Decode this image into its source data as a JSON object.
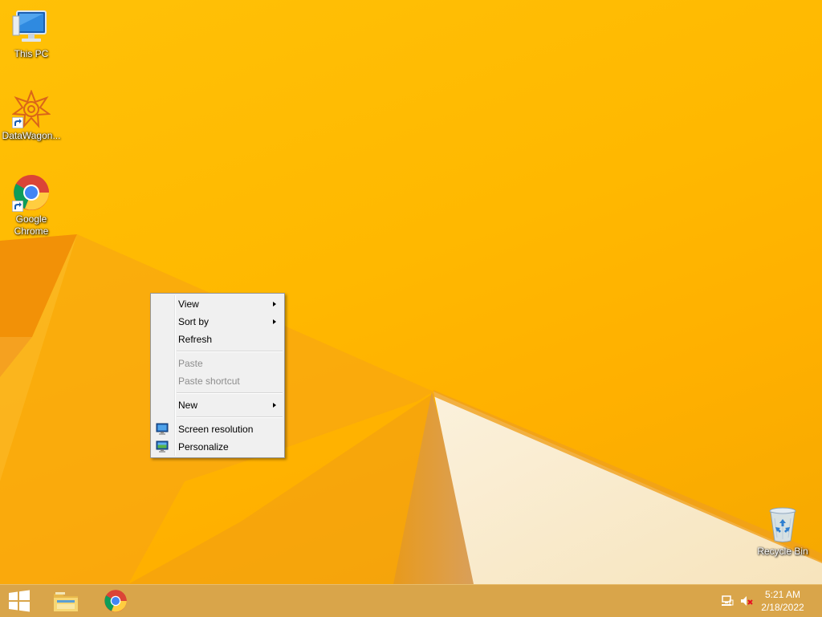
{
  "desktop": {
    "icons": [
      {
        "label": "This PC",
        "icon": "this-pc-icon"
      },
      {
        "label": "DataWagon...",
        "icon": "datawagon-icon"
      },
      {
        "label": "Google Chrome",
        "icon": "chrome-icon"
      },
      {
        "label": "Recycle Bin",
        "icon": "recycle-bin-icon"
      }
    ]
  },
  "context_menu": {
    "items": [
      {
        "label": "View",
        "submenu": true,
        "enabled": true
      },
      {
        "label": "Sort by",
        "submenu": true,
        "enabled": true
      },
      {
        "label": "Refresh",
        "submenu": false,
        "enabled": true
      },
      {
        "label": "Paste",
        "submenu": false,
        "enabled": false
      },
      {
        "label": "Paste shortcut",
        "submenu": false,
        "enabled": false
      },
      {
        "label": "New",
        "submenu": true,
        "enabled": true
      },
      {
        "label": "Screen resolution",
        "submenu": false,
        "enabled": true,
        "icon": "screen-resolution-icon"
      },
      {
        "label": "Personalize",
        "submenu": false,
        "enabled": true,
        "icon": "personalize-icon"
      }
    ]
  },
  "taskbar": {
    "pinned": [
      {
        "icon": "windows-start-icon"
      },
      {
        "icon": "file-explorer-icon"
      },
      {
        "icon": "chrome-icon"
      }
    ],
    "tray": [
      {
        "icon": "network-icon"
      },
      {
        "icon": "volume-muted-icon"
      }
    ],
    "clock": {
      "time": "5:21 AM",
      "date": "2/18/2022"
    }
  },
  "colors": {
    "wallpaper": "#ffb800",
    "taskbar": "#d9a54a",
    "menu_bg": "#f0f0f0"
  }
}
